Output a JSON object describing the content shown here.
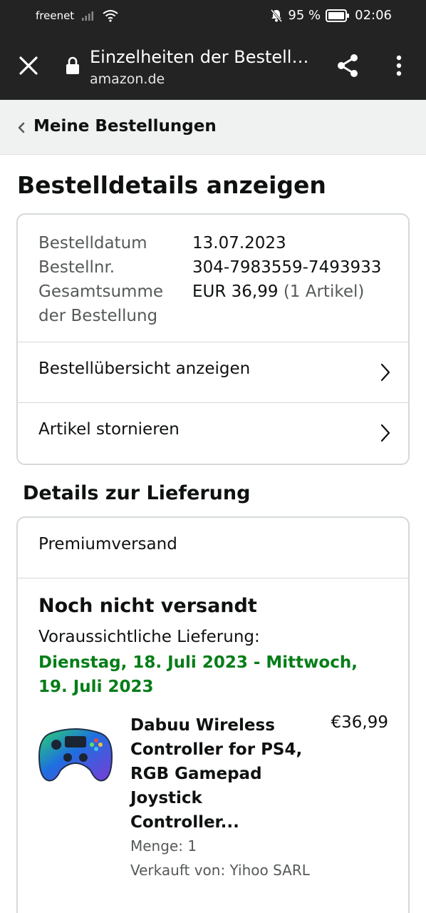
{
  "status_bar": {
    "carrier": "freenet",
    "battery": "95 %",
    "time": "02:06"
  },
  "browser": {
    "title": "Einzelheiten der Bestellung",
    "url": "amazon.de"
  },
  "nav": {
    "back_label": "Meine Bestellungen"
  },
  "page": {
    "title": "Bestelldetails anzeigen"
  },
  "order": {
    "date_label": "Bestelldatum",
    "date": "13.07.2023",
    "number_label": "Bestellnr.",
    "number": "304-7983559-7493933",
    "total_label_line1": "Gesamtsumme",
    "total_label_line2": "der Bestellung",
    "total": "EUR 36,99",
    "item_count": "(1 Artikel)",
    "overview_link": "Bestellübersicht anzeigen",
    "cancel_link": "Artikel stornieren"
  },
  "delivery": {
    "heading": "Details zur Lieferung",
    "method": "Premiumversand",
    "status": "Noch nicht versandt",
    "expected_label": "Voraussichtliche Lieferung:",
    "expected_date": "Dienstag, 18. Juli 2023 - Mittwoch, 19. Juli 2023"
  },
  "product": {
    "title": "Dabuu Wireless Controller for PS4, RGB Gamepad Joystick Controller...",
    "price": "€36,99",
    "quantity": "Menge: 1",
    "seller": "Verkauft von: Yihoo SARL"
  },
  "colors": {
    "topbar": "#232323",
    "delivery_green": "#067d18",
    "secondary_text": "#565959"
  }
}
